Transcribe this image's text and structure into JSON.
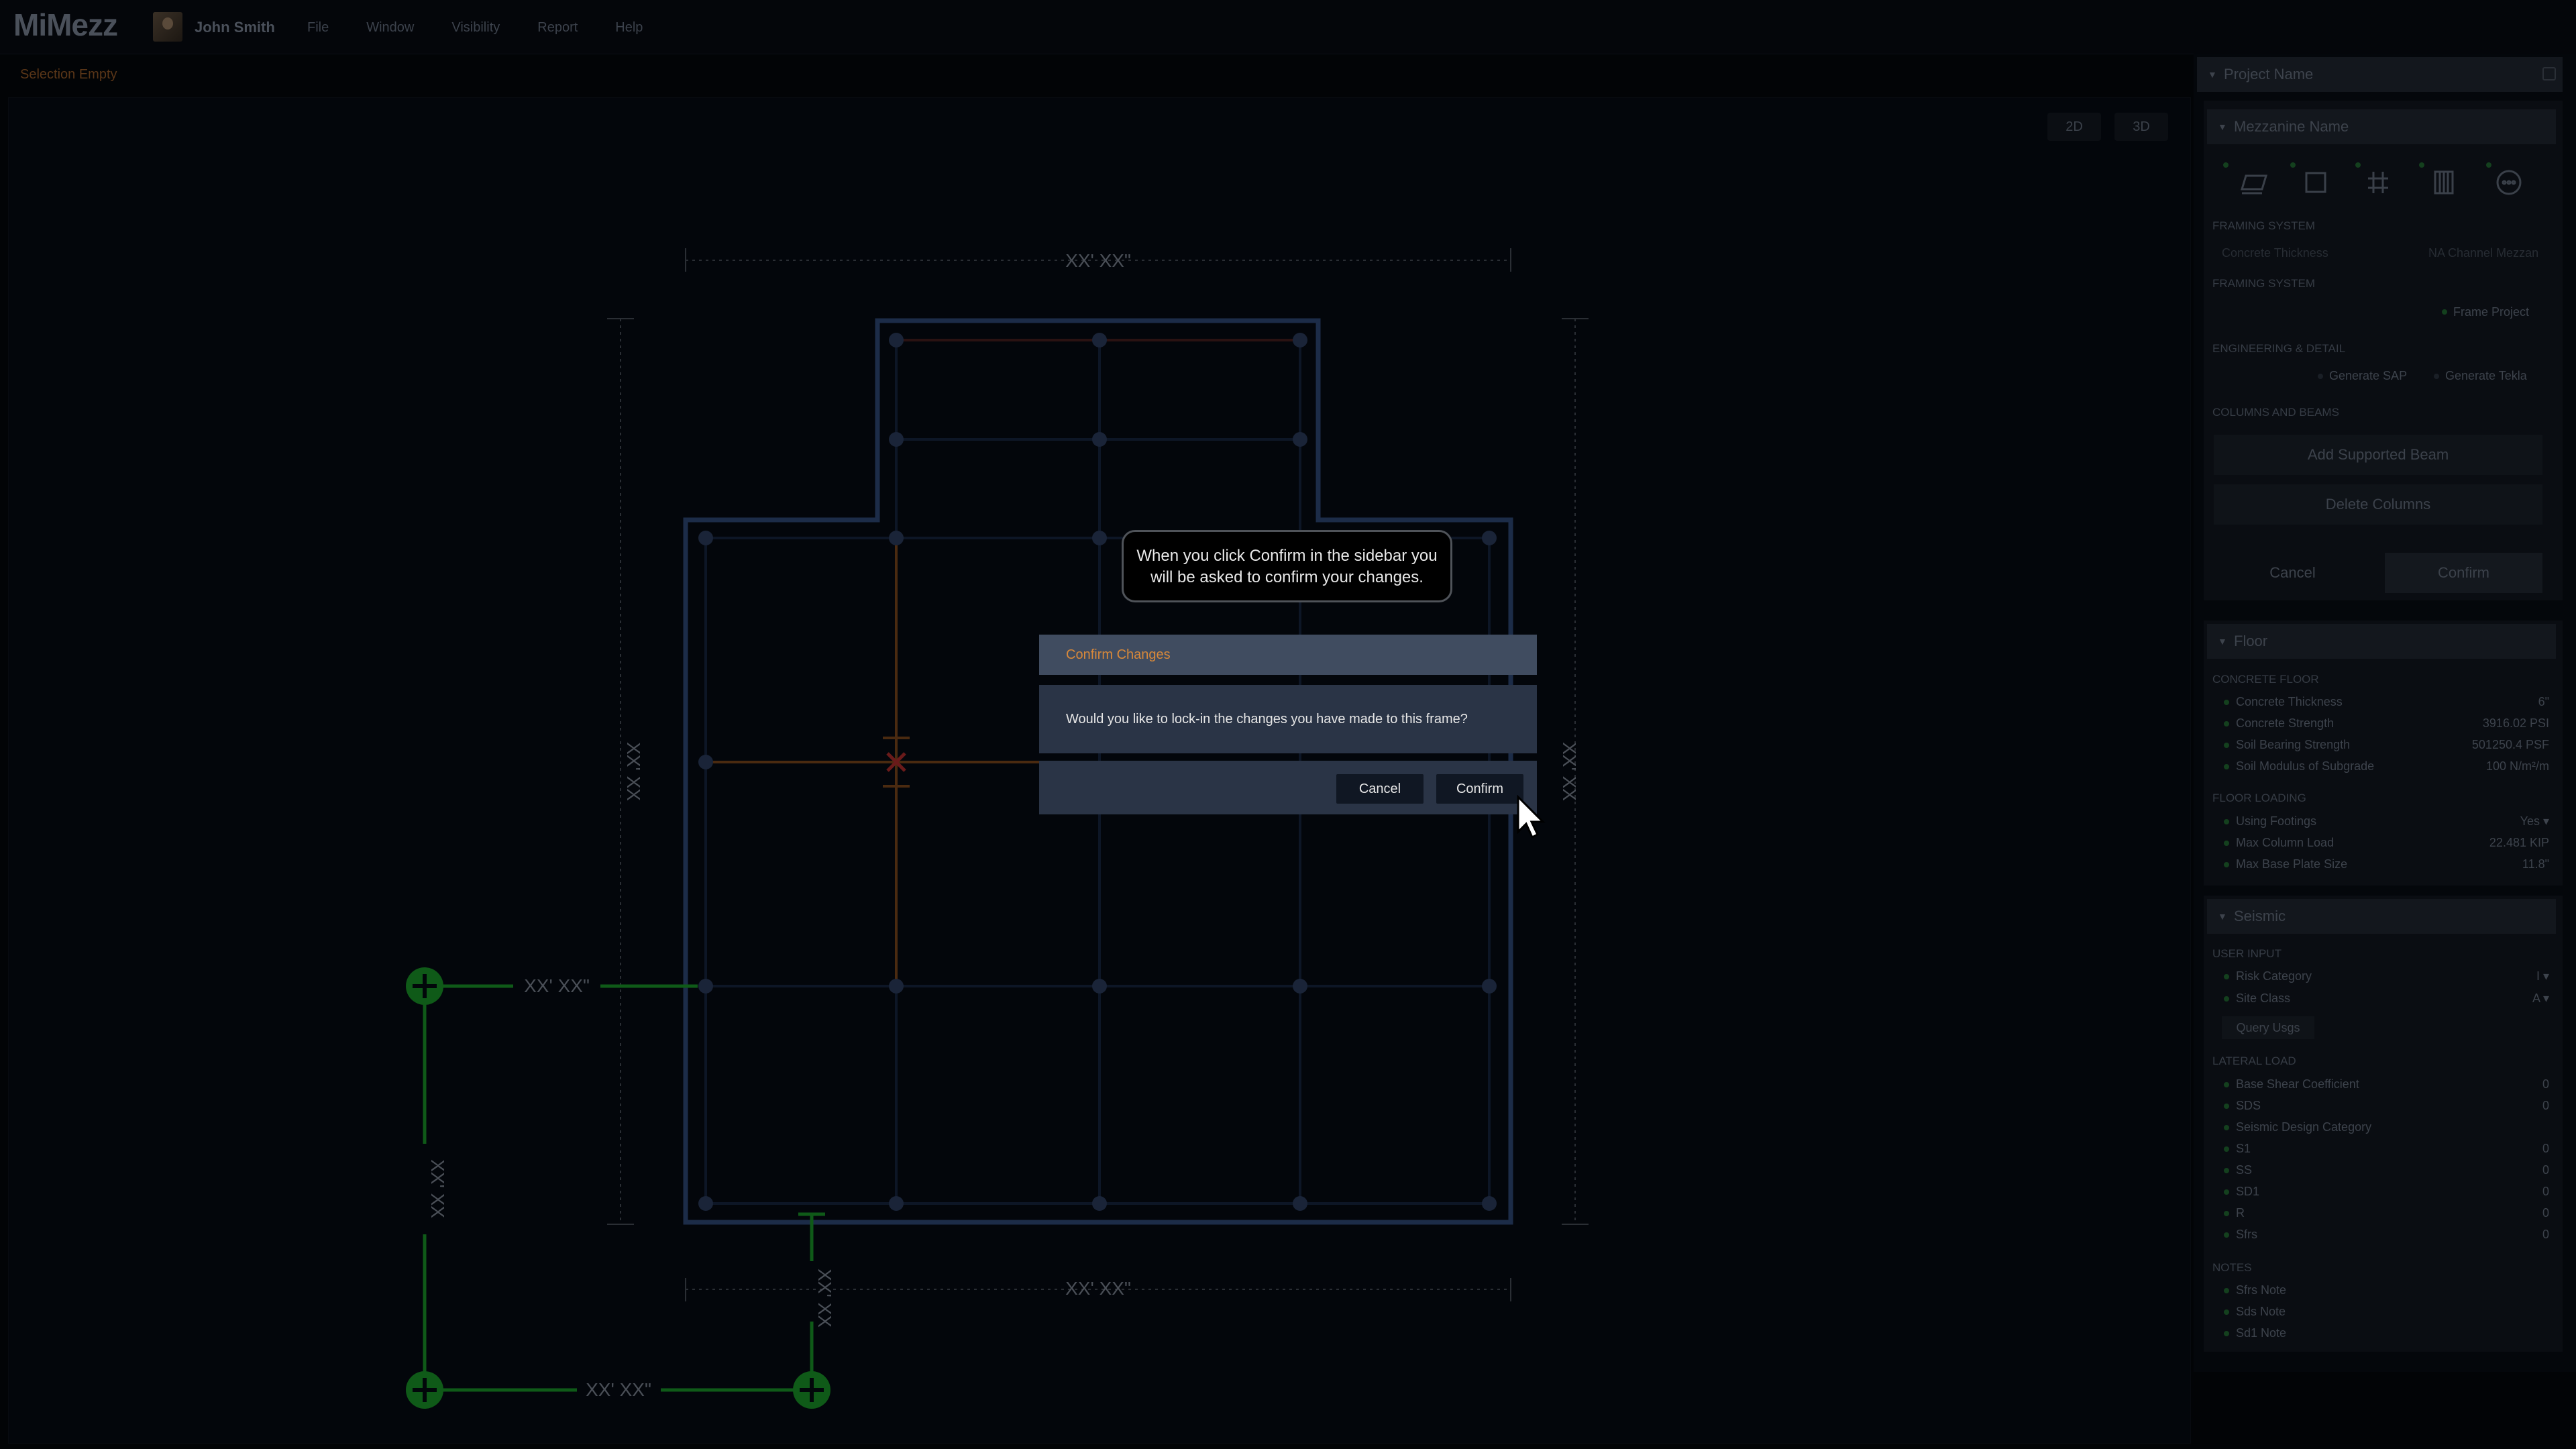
{
  "app": {
    "logo": "MiMezz",
    "user": "John Smith"
  },
  "menu": [
    "File",
    "Window",
    "Visibility",
    "Report",
    "Help"
  ],
  "selection_status": "Selection Empty",
  "view_toggle": {
    "two_d": "2D",
    "three_d": "3D"
  },
  "dimensions": {
    "top": "XX' XX\"",
    "bottom": "XX' XX\"",
    "left": "XX' XX",
    "right": "XX' XX",
    "green_horizontal_1": "XX' XX\"",
    "green_horizontal_2": "XX' XX\"",
    "green_vertical_1": "XX' XX",
    "green_vertical_2": "XX' XX"
  },
  "tooltip": {
    "line1": "When you click Confirm in the sidebar you",
    "line2": "will be asked to confirm your changes."
  },
  "dialog": {
    "title": "Confirm Changes",
    "message": "Would you like to lock-in the changes you have made to this frame?",
    "cancel": "Cancel",
    "confirm": "Confirm"
  },
  "sidebar": {
    "project_name": "Project Name",
    "mezzanine_name": "Mezzanine Name",
    "tool_icons": [
      "layers-icon",
      "frame-icon",
      "grid-icon",
      "columns-icon",
      "more-icon"
    ],
    "framing_system_label": "FRAMING SYSTEM",
    "concrete_thickness_placeholder": "Concrete Thickness",
    "channel_label": "NA Channel Mezzan",
    "framing_system_label_2": "FRAMING SYSTEM",
    "frame_project": "Frame Project",
    "engineering_label": "ENGINEERING & DETAIL",
    "generate_sap": "Generate SAP",
    "generate_tekla": "Generate Tekla",
    "columns_beams_label": "COLUMNS AND BEAMS",
    "add_supported_beam": "Add Supported Beam",
    "delete_columns": "Delete Columns",
    "cancel": "Cancel",
    "confirm": "Confirm",
    "floor": {
      "title": "Floor",
      "concrete_floor_label": "CONCRETE FLOOR",
      "rows": [
        {
          "label": "Concrete Thickness",
          "value": "6\""
        },
        {
          "label": "Concrete Strength",
          "value": "3916.02 PSI"
        },
        {
          "label": "Soil Bearing Strength",
          "value": "501250.4 PSF"
        },
        {
          "label": "Soil Modulus of Subgrade",
          "value": "100 N/m²/m"
        }
      ],
      "floor_loading_label": "FLOOR LOADING",
      "loading_rows": [
        {
          "label": "Using Footings",
          "value": "Yes  ▾"
        },
        {
          "label": "Max Column Load",
          "value": "22.481 KIP"
        },
        {
          "label": "Max Base Plate Size",
          "value": "11.8\""
        }
      ]
    },
    "seismic": {
      "title": "Seismic",
      "user_input_label": "USER INPUT",
      "input_rows": [
        {
          "label": "Risk Category",
          "value": "I  ▾"
        },
        {
          "label": "Site Class",
          "value": "A  ▾"
        }
      ],
      "query_usgs": "Query Usgs",
      "lateral_load_label": "LATERAL LOAD",
      "lateral_rows": [
        {
          "label": "Base Shear Coefficient",
          "value": "0"
        },
        {
          "label": "SDS",
          "value": "0"
        },
        {
          "label": "Seismic Design Category",
          "value": ""
        },
        {
          "label": "S1",
          "value": "0"
        },
        {
          "label": "SS",
          "value": "0"
        },
        {
          "label": "SD1",
          "value": "0"
        },
        {
          "label": "R",
          "value": "0"
        },
        {
          "label": "Sfrs",
          "value": "0"
        }
      ],
      "notes_label": "NOTES",
      "notes": [
        "Sfrs Note",
        "Sds Note",
        "Sd1 Note"
      ]
    }
  },
  "colors": {
    "dialog_title_bg": "#404c60",
    "dialog_title_text": "#d9893a",
    "dialog_body_bg": "#2a3446",
    "frame_outline": "#1c2c48",
    "green_handle": "#0f5a18"
  }
}
